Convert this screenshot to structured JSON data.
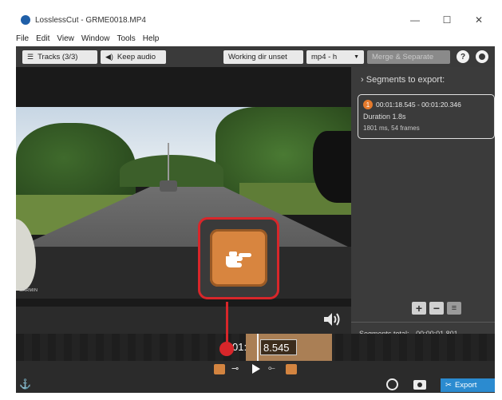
{
  "window": {
    "title": "LosslessCut - GRME0018.MP4",
    "minimize": "—",
    "maximize": "☐",
    "close": "✕"
  },
  "menu": [
    "File",
    "Edit",
    "View",
    "Window",
    "Tools",
    "Help"
  ],
  "toolbar": {
    "tracks_label": "Tracks (3/3)",
    "audio_label": "Keep audio",
    "working_dir_label": "Working dir unset",
    "format_label": "mp4 - h",
    "merge_label": "Merge & Separate",
    "help_label": "?"
  },
  "video": {
    "watermark": "GARMIN"
  },
  "segments_panel": {
    "header": "Segments to export:",
    "segments": [
      {
        "number": "1",
        "range": "00:01:18.545 - 00:01:20.346",
        "duration": "Duration 1.8s",
        "frames": "1801 ms, 54 frames"
      }
    ],
    "total_label": "Segments total:",
    "total_value": "00:00:01.801",
    "add_label": "+",
    "remove_label": "−",
    "list_label": "≡"
  },
  "timeline": {
    "time_prefix": "01:",
    "time_value": "8.545"
  },
  "controls": {
    "export_label": "Export"
  },
  "colors": {
    "accent_orange": "#d8853f",
    "callout_red": "#d8262a",
    "export_blue": "#2b8bd0"
  }
}
